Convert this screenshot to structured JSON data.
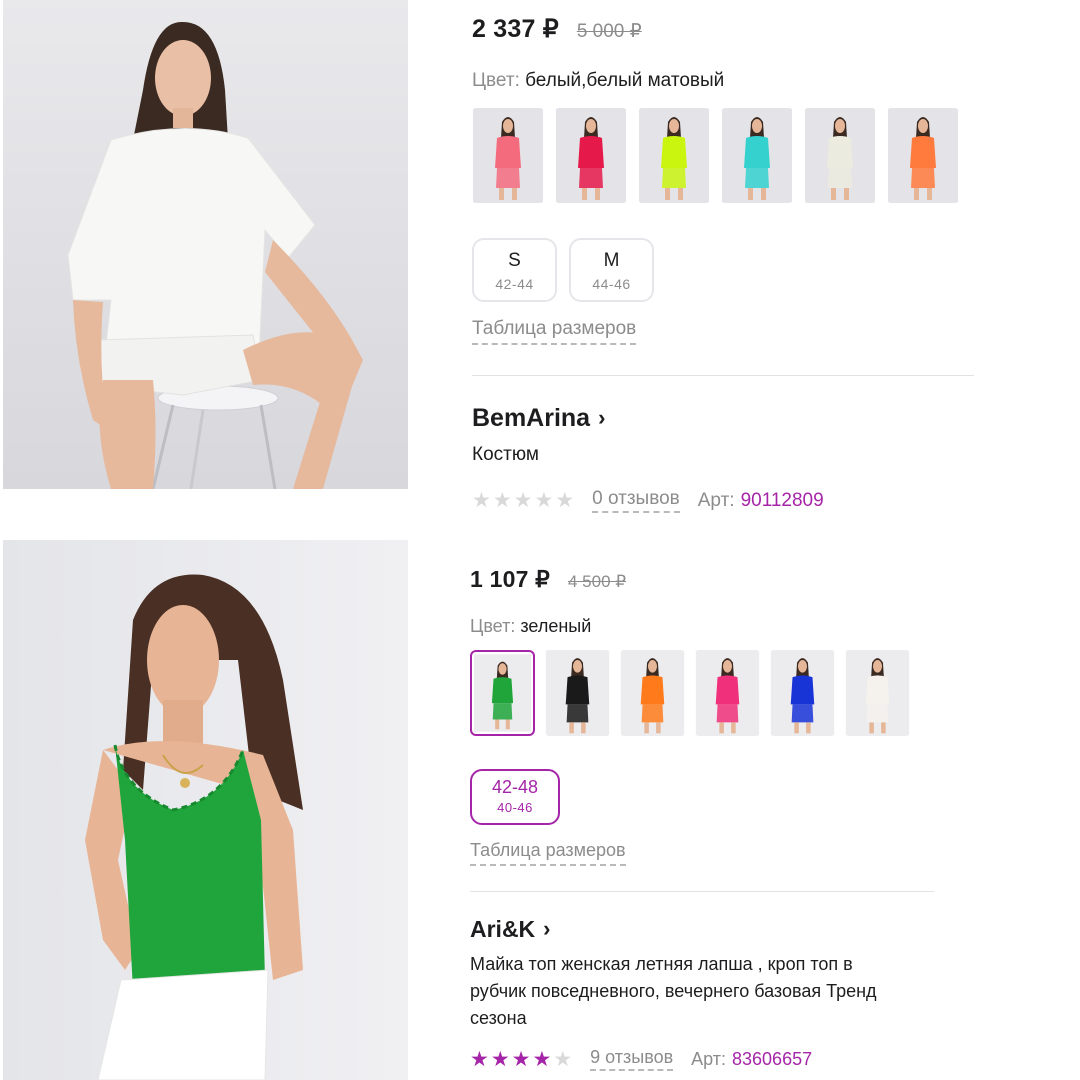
{
  "colors": {
    "accent": "#a525a8",
    "star_filled": "#a525a8",
    "star_empty": "#d9d9d9",
    "muted": "#8c8c8c"
  },
  "products": [
    {
      "price": "2 337 ₽",
      "old_price": "5 000 ₽",
      "color_label": "Цвет:",
      "color_value": "белый,белый матовый",
      "thumb_colors": [
        "#f56b7e",
        "#e6194b",
        "#c9f50f",
        "#34d1cf",
        "#ecebdf",
        "#ff7a3d"
      ],
      "sizes": [
        {
          "size": "S",
          "range": "42-44"
        },
        {
          "size": "M",
          "range": "44-46"
        }
      ],
      "size_table": "Таблица размеров",
      "brand": "BemArina",
      "name": "Костюм",
      "rating": 0,
      "reviews": "0 отзывов",
      "art_label": "Арт:",
      "art_value": "90112809"
    },
    {
      "price": "1 107 ₽",
      "old_price": "4 500 ₽",
      "color_label": "Цвет:",
      "color_value": "зеленый",
      "thumb_colors": [
        "#1fa53a",
        "#1a1a1a",
        "#ff7a1a",
        "#f0307a",
        "#1834d6",
        "#f5f1ec"
      ],
      "sizes": [
        {
          "size": "42-48",
          "range": "40-46"
        }
      ],
      "size_table": "Таблица размеров",
      "brand": "Ari&K",
      "name_lines": [
        "Майка топ женская летняя лапша , кроп топ в",
        "рубчик повседневного, вечернего базовая Тренд",
        "сезона"
      ],
      "rating": 4,
      "reviews": "9 отзывов",
      "art_label": "Арт:",
      "art_value": "83606657"
    }
  ]
}
